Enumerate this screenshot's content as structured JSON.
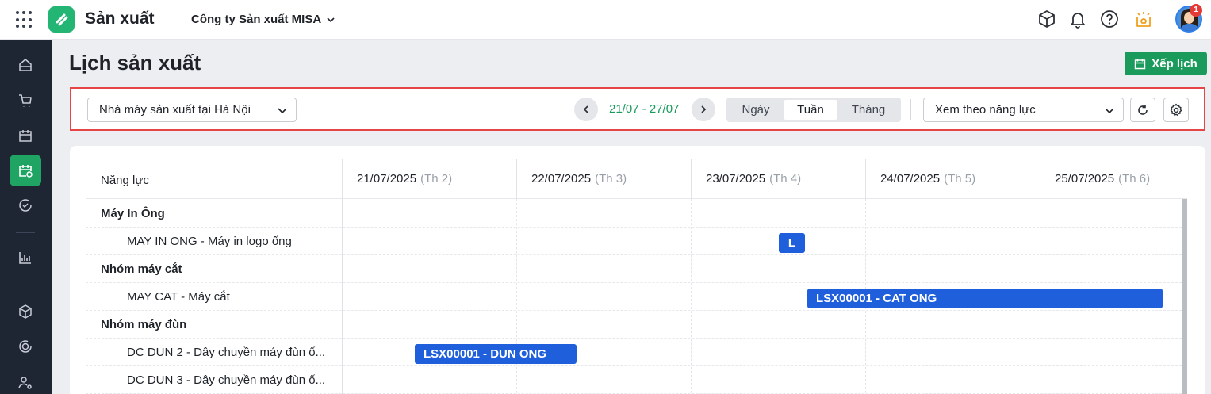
{
  "header": {
    "app_title": "Sản xuất",
    "company": "Công ty Sản xuất MISA",
    "notification_count": "1",
    "icons": [
      "apps-grid-icon",
      "app-logo-icon",
      "chevron-down-icon",
      "package-icon",
      "bell-icon",
      "help-icon",
      "idea-icon",
      "avatar"
    ]
  },
  "sidebar": {
    "items": [
      "home-icon",
      "cart-icon",
      "calendar-icon",
      "production-schedule-icon",
      "check-circle-icon",
      "chart-icon",
      "box-icon",
      "cycle-icon",
      "user-settings-icon"
    ],
    "active": "production-schedule-icon"
  },
  "page": {
    "title": "Lịch sản xuất",
    "schedule_button": "Xếp lịch"
  },
  "toolbar": {
    "factory": "Nhà máy sản xuất tại Hà Nội",
    "date_range": "21/07 - 27/07",
    "modes": [
      "Ngày",
      "Tuần",
      "Tháng"
    ],
    "active_mode": "Tuần",
    "view_by": "Xem theo năng lực"
  },
  "calendar": {
    "capacity_header": "Năng lực",
    "days": [
      {
        "date": "21/07/2025",
        "weekday": "(Th 2)"
      },
      {
        "date": "22/07/2025",
        "weekday": "(Th 3)"
      },
      {
        "date": "23/07/2025",
        "weekday": "(Th 4)"
      },
      {
        "date": "24/07/2025",
        "weekday": "(Th 5)"
      },
      {
        "date": "25/07/2025",
        "weekday": "(Th 6)"
      }
    ],
    "rows": [
      {
        "label": "Máy In Ông",
        "type": "group"
      },
      {
        "label": "MAY IN ONG - Máy in logo ống",
        "type": "child"
      },
      {
        "label": "Nhóm máy cắt",
        "type": "group"
      },
      {
        "label": "MAY CAT - Máy cắt",
        "type": "child"
      },
      {
        "label": "Nhóm máy đùn",
        "type": "group"
      },
      {
        "label": "DC DUN 2 - Dây chuyền máy đùn ố...",
        "type": "child"
      },
      {
        "label": "DC DUN 3 - Dây chuyền máy đùn ố...",
        "type": "child"
      }
    ],
    "tasks": [
      {
        "label": "L",
        "row": 1
      },
      {
        "label": "LSX00001 - CAT ONG",
        "row": 3
      },
      {
        "label": "LSX00001 - DUN ONG",
        "row": 5
      }
    ]
  }
}
